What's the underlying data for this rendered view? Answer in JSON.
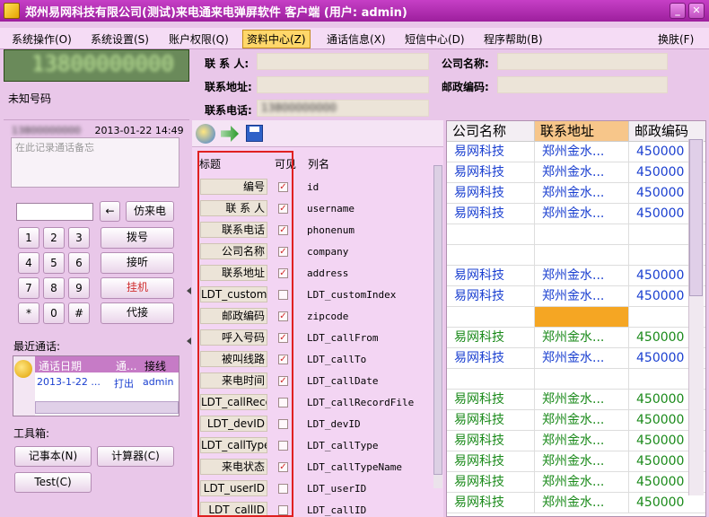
{
  "window": {
    "title": "郑州易网科技有限公司(测试)来电通来电弹屏软件 客户端 (用户: admin)",
    "minimize": "_",
    "close": "✕"
  },
  "menu": {
    "items": [
      "系统操作(O)",
      "系统设置(S)",
      "账户权限(Q)",
      "资料中心(Z)",
      "通话信息(X)",
      "短信中心(D)",
      "程序帮助(B)"
    ],
    "skin": "换肤(F)"
  },
  "caller": {
    "number": "13800000000",
    "status": "未知号码"
  },
  "contact_form": {
    "name_label": "联 系 人:",
    "company_label": "公司名称:",
    "address_label": "联系地址:",
    "zip_label": "邮政编码:",
    "phone_label": "联系电话:",
    "phone_value": "13800000000"
  },
  "call_info": {
    "number": "13800000000",
    "datetime": "2013-01-22 14:49",
    "memo_placeholder": "在此记录通话备忘"
  },
  "dialpad": {
    "back": "←",
    "fake_call": "仿来电",
    "dial": "拨号",
    "answer": "接听",
    "hangup": "挂机",
    "transfer": "代接",
    "keys": [
      "1",
      "2",
      "3",
      "4",
      "5",
      "6",
      "7",
      "8",
      "9",
      "*",
      "0",
      "#"
    ]
  },
  "recent": {
    "title": "最近通话:",
    "headers": [
      "通话日期",
      "通...",
      "接线"
    ],
    "rows": [
      [
        "2013-1-22 ...",
        "打出",
        "admin"
      ]
    ]
  },
  "tools": {
    "title": "工具箱:",
    "notepad": "记事本(N)",
    "calculator": "计算器(C)",
    "test": "Test(C)"
  },
  "field_config": {
    "headers": {
      "title": "标题",
      "visible": "可见",
      "column": "列名"
    },
    "rows": [
      {
        "title": "编号",
        "visible": true,
        "column": "id"
      },
      {
        "title": "联 系 人",
        "visible": true,
        "column": "username"
      },
      {
        "title": "联系电话",
        "visible": true,
        "column": "phonenum"
      },
      {
        "title": "公司名称",
        "visible": true,
        "column": "company"
      },
      {
        "title": "联系地址",
        "visible": true,
        "column": "address"
      },
      {
        "title": "LDT_customIndex",
        "visible": false,
        "column": "LDT_customIndex"
      },
      {
        "title": "邮政编码",
        "visible": true,
        "column": "zipcode"
      },
      {
        "title": "呼入号码",
        "visible": true,
        "column": "LDT_callFrom"
      },
      {
        "title": "被叫线路",
        "visible": true,
        "column": "LDT_callTo"
      },
      {
        "title": "来电时间",
        "visible": true,
        "column": "LDT_callDate"
      },
      {
        "title": "LDT_callRecordFile",
        "visible": false,
        "column": "LDT_callRecordFile"
      },
      {
        "title": "LDT_devID",
        "visible": false,
        "column": "LDT_devID"
      },
      {
        "title": "LDT_callType",
        "visible": false,
        "column": "LDT_callType"
      },
      {
        "title": "来电状态",
        "visible": true,
        "column": "LDT_callTypeName"
      },
      {
        "title": "LDT_userID",
        "visible": false,
        "column": "LDT_userID"
      },
      {
        "title": "LDT_callID",
        "visible": false,
        "column": "LDT_callID"
      }
    ]
  },
  "grid": {
    "headers": [
      "公司名称",
      "联系地址",
      "邮政编码"
    ],
    "rows": [
      {
        "company": "易网科技",
        "address": "郑州金水...",
        "zip": "450000",
        "color": "blue"
      },
      {
        "company": "易网科技",
        "address": "郑州金水...",
        "zip": "450000",
        "color": "blue"
      },
      {
        "company": "易网科技",
        "address": "郑州金水...",
        "zip": "450000",
        "color": "blue"
      },
      {
        "company": "易网科技",
        "address": "郑州金水...",
        "zip": "450000",
        "color": "blue"
      },
      {
        "company": "",
        "address": "",
        "zip": "",
        "color": "blue"
      },
      {
        "company": "",
        "address": "",
        "zip": "",
        "color": "blue"
      },
      {
        "company": "易网科技",
        "address": "郑州金水...",
        "zip": "450000",
        "color": "blue"
      },
      {
        "company": "易网科技",
        "address": "郑州金水...",
        "zip": "450000",
        "color": "blue"
      },
      {
        "company": "",
        "address": "",
        "zip": "",
        "color": "blue",
        "selected": true
      },
      {
        "company": "易网科技",
        "address": "郑州金水...",
        "zip": "450000",
        "color": "green"
      },
      {
        "company": "易网科技",
        "address": "郑州金水...",
        "zip": "450000",
        "color": "blue"
      },
      {
        "company": "",
        "address": "",
        "zip": "",
        "color": "blue"
      },
      {
        "company": "易网科技",
        "address": "郑州金水...",
        "zip": "450000",
        "color": "green"
      },
      {
        "company": "易网科技",
        "address": "郑州金水...",
        "zip": "450000",
        "color": "green"
      },
      {
        "company": "易网科技",
        "address": "郑州金水...",
        "zip": "450000",
        "color": "green"
      },
      {
        "company": "易网科技",
        "address": "郑州金水...",
        "zip": "450000",
        "color": "green"
      },
      {
        "company": "易网科技",
        "address": "郑州金水...",
        "zip": "450000",
        "color": "green"
      },
      {
        "company": "易网科技",
        "address": "郑州金水...",
        "zip": "450000",
        "color": "green"
      }
    ]
  },
  "colors": {
    "title_bar": "#b12eb1",
    "panel_bg": "#e9c7e9",
    "accent_active_menu": "#ffd76a",
    "row_blue": "#1a3fd0",
    "row_green": "#1a8a1a",
    "highlight_cell": "#f5a623",
    "red_outline": "#e02020"
  }
}
